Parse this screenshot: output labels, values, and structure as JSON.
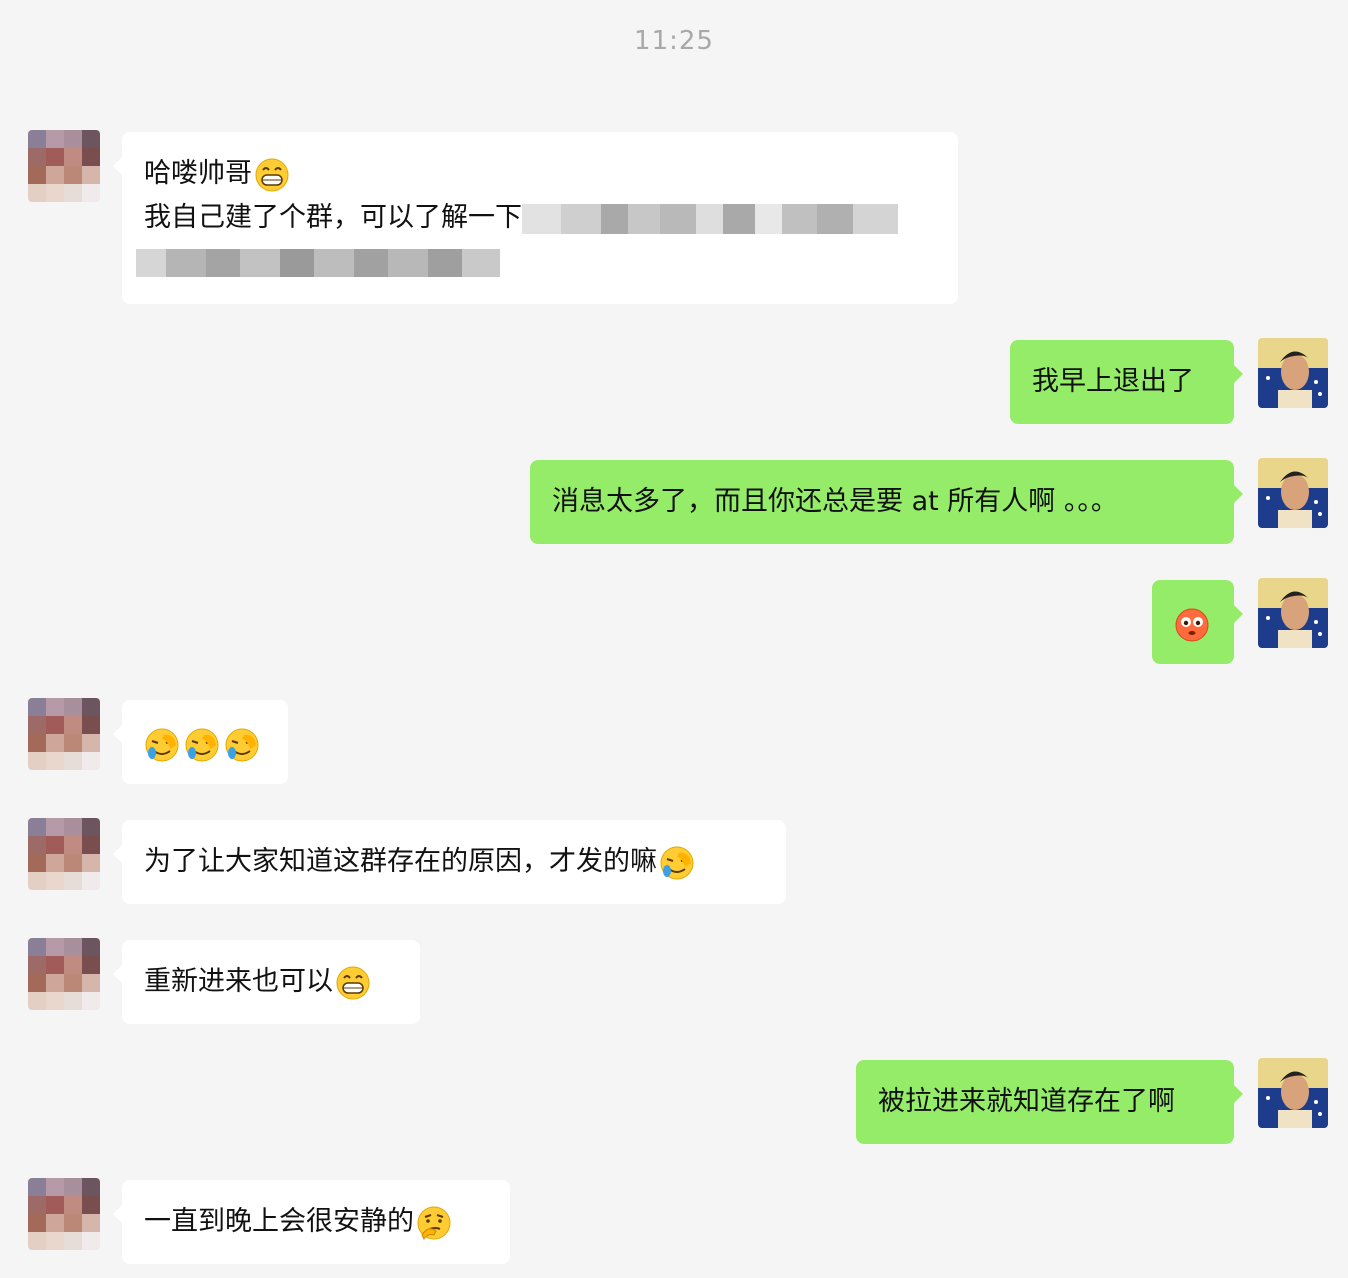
{
  "timestamp": "11:25",
  "messages": [
    {
      "id": 1,
      "side": "left",
      "lines": [
        "哈喽帅哥",
        "我自己建了个群，可以了解一下"
      ],
      "emojis": [
        "grin-icon"
      ],
      "redacted": true
    },
    {
      "id": 2,
      "side": "right",
      "text": "我早上退出了"
    },
    {
      "id": 3,
      "side": "right",
      "text": "消息太多了，而且你还总是要 at 所有人啊 。。。"
    },
    {
      "id": 4,
      "side": "right",
      "text": "",
      "emojis": [
        "flushed-icon"
      ]
    },
    {
      "id": 5,
      "side": "left",
      "text": "",
      "emojis": [
        "facepalm-icon",
        "facepalm-icon",
        "facepalm-icon"
      ]
    },
    {
      "id": 6,
      "side": "left",
      "text": "为了让大家知道这群存在的原因，才发的嘛",
      "emojis": [
        "facepalm-icon"
      ]
    },
    {
      "id": 7,
      "side": "left",
      "text": "重新进来也可以",
      "emojis": [
        "grin-icon"
      ]
    },
    {
      "id": 8,
      "side": "right",
      "text": "被拉进来就知道存在了啊"
    },
    {
      "id": 9,
      "side": "left",
      "text": "一直到晚上会很安静的",
      "emojis": [
        "thinking-icon"
      ]
    }
  ],
  "colors": {
    "background": "#f5f5f5",
    "bubble_left": "#ffffff",
    "bubble_right": "#95ec69",
    "timestamp": "#a8a8a8"
  }
}
